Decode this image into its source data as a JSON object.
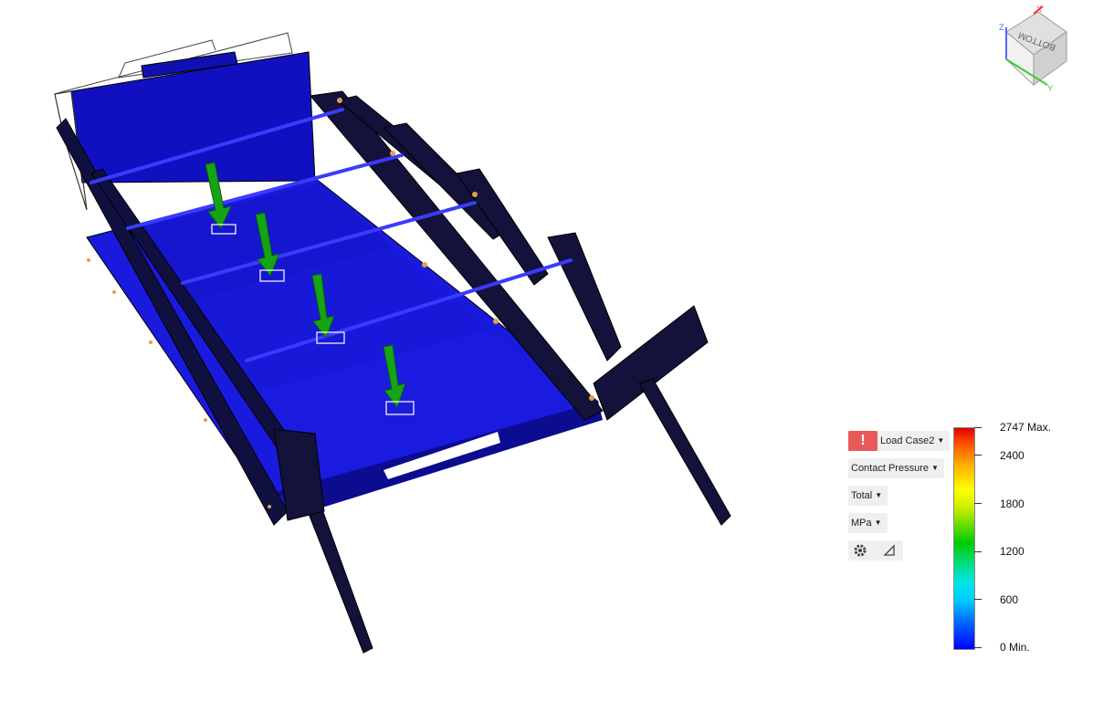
{
  "results_panel": {
    "load_case": "Load Case2",
    "result_type": "Contact Pressure",
    "component": "Total",
    "units": "MPa"
  },
  "legend": {
    "max_label": "2747 Max.",
    "min_label": "0 Min.",
    "ticks": [
      "2400",
      "1800",
      "1200",
      "600"
    ],
    "colors": {
      "max": "#dd0000",
      "min": "#0000ff",
      "mid": "#00cc00"
    }
  },
  "viewcube": {
    "face": "BOTTOM",
    "axes": [
      "X",
      "Y",
      "Z"
    ]
  },
  "icons": [
    "warning-icon",
    "settings-gear-icon",
    "probe-icon",
    "load-arrow-icon",
    "view-cube-icon"
  ]
}
